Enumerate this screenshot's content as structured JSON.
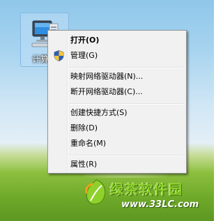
{
  "desktop": {
    "icon_label": "计算机"
  },
  "context_menu": {
    "items": [
      {
        "label": "打开(O)",
        "bold": true
      },
      {
        "label": "管理(G)",
        "icon": "uac-shield-icon"
      },
      {
        "label": "映射网络驱动器(N)..."
      },
      {
        "label": "断开网络驱动器(C)..."
      },
      {
        "label": "创建快捷方式(S)"
      },
      {
        "label": "删除(D)"
      },
      {
        "label": "重命名(M)"
      },
      {
        "label": "属性(R)"
      }
    ]
  },
  "watermark": {
    "text": "绿茶软件园",
    "url": "www.33LC.com"
  },
  "colors": {
    "menu_background": "#f1f1f1",
    "menu_border": "#979797",
    "watermark_green": "#8fd12b"
  }
}
